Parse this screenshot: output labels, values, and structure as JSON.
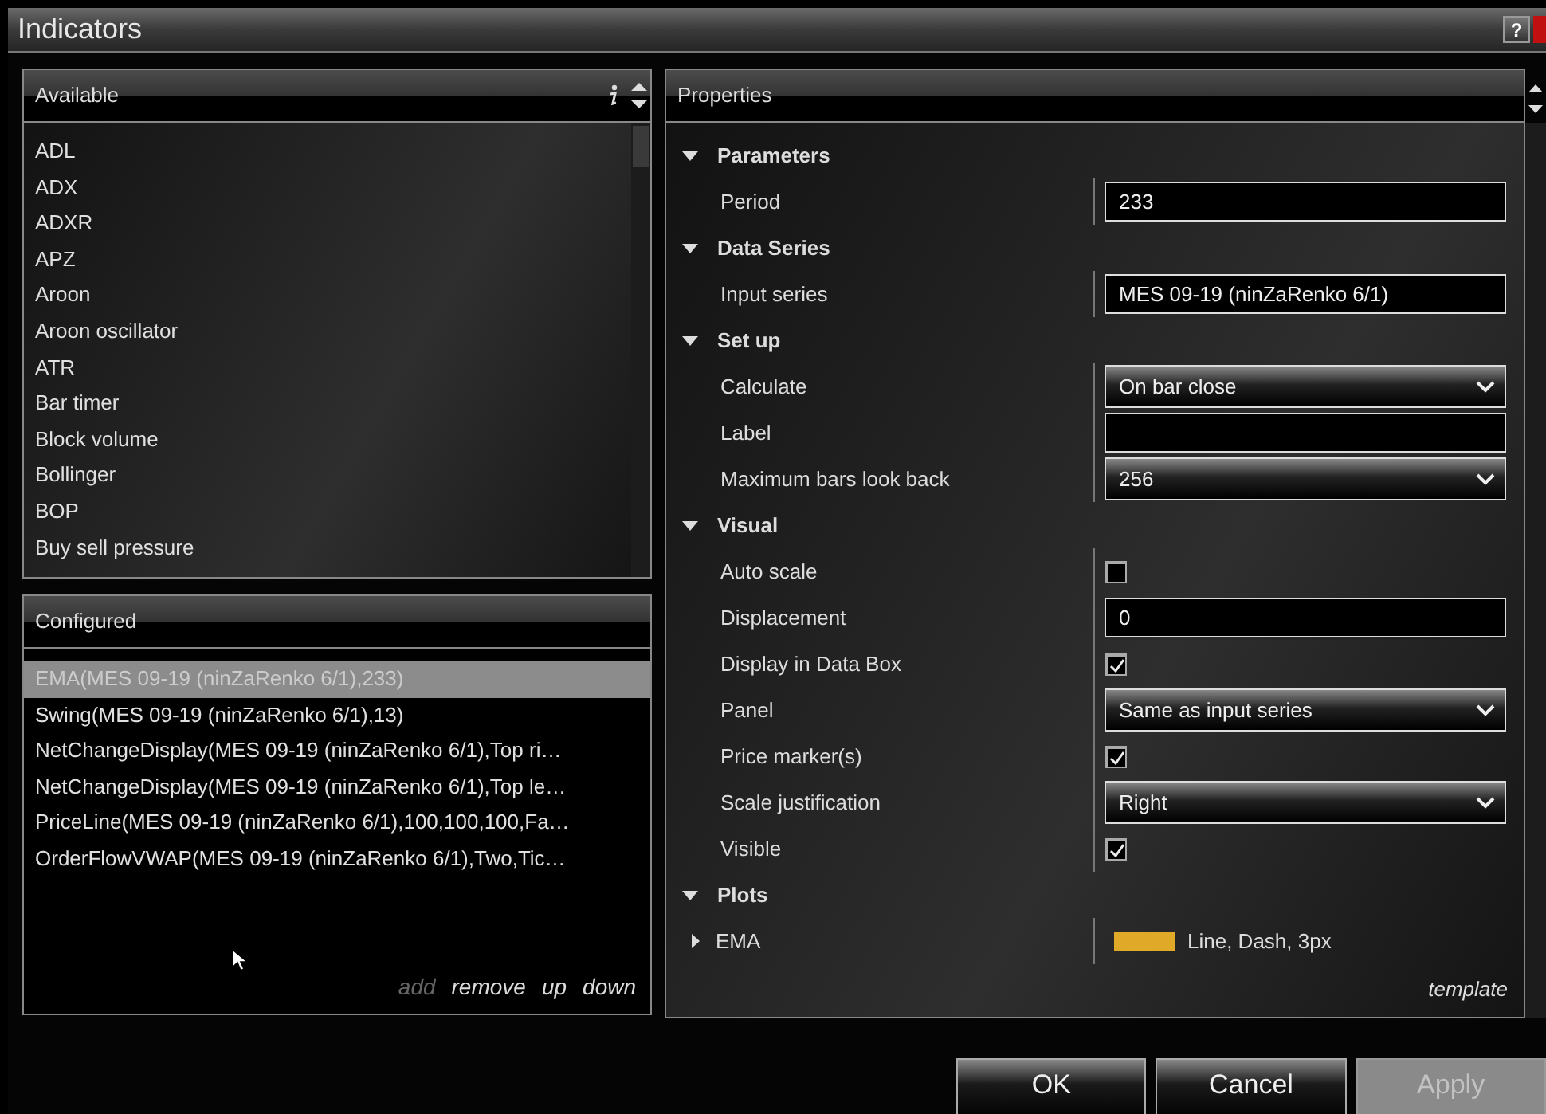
{
  "window": {
    "title": "Indicators",
    "help": "?"
  },
  "available": {
    "title": "Available",
    "items": [
      "ADL",
      "ADX",
      "ADXR",
      "APZ",
      "Aroon",
      "Aroon oscillator",
      "ATR",
      "Bar timer",
      "Block volume",
      "Bollinger",
      "BOP",
      "Buy sell pressure"
    ]
  },
  "configured": {
    "title": "Configured",
    "items": [
      {
        "label": "EMA(MES 09-19 (ninZaRenko 6/1),233)",
        "selected": true
      },
      {
        "label": "Swing(MES 09-19 (ninZaRenko 6/1),13)",
        "selected": false
      },
      {
        "label": "NetChangeDisplay(MES 09-19 (ninZaRenko 6/1),Top ri…",
        "selected": false
      },
      {
        "label": "NetChangeDisplay(MES 09-19 (ninZaRenko 6/1),Top le…",
        "selected": false
      },
      {
        "label": "PriceLine(MES 09-19 (ninZaRenko 6/1),100,100,100,Fa…",
        "selected": false
      },
      {
        "label": "OrderFlowVWAP(MES 09-19 (ninZaRenko 6/1),Two,Tic…",
        "selected": false
      }
    ],
    "actions": [
      {
        "label": "add",
        "disabled": true
      },
      {
        "label": "remove",
        "disabled": false
      },
      {
        "label": "up",
        "disabled": false
      },
      {
        "label": "down",
        "disabled": false
      }
    ]
  },
  "properties": {
    "title": "Properties",
    "groups": [
      {
        "name": "Parameters",
        "expanded": true,
        "rows": [
          {
            "label": "Period",
            "kind": "text",
            "value": "233"
          }
        ]
      },
      {
        "name": "Data Series",
        "expanded": true,
        "rows": [
          {
            "label": "Input series",
            "kind": "text",
            "value": "MES 09-19 (ninZaRenko 6/1)"
          }
        ]
      },
      {
        "name": "Set up",
        "expanded": true,
        "rows": [
          {
            "label": "Calculate",
            "kind": "dropdown",
            "value": "On bar close"
          },
          {
            "label": "Label",
            "kind": "text"
          },
          {
            "label": "Maximum bars look back",
            "kind": "dropdown",
            "value": "256"
          }
        ]
      },
      {
        "name": "Visual",
        "expanded": true,
        "rows": [
          {
            "label": "Auto scale",
            "kind": "checkbox",
            "checked": false
          },
          {
            "label": "Displacement",
            "kind": "text",
            "value": "0"
          },
          {
            "label": "Display in Data Box",
            "kind": "checkbox",
            "checked": true
          },
          {
            "label": "Panel",
            "kind": "dropdown",
            "value": "Same as input series"
          },
          {
            "label": "Price marker(s)",
            "kind": "checkbox",
            "checked": true
          },
          {
            "label": "Scale justification",
            "kind": "dropdown",
            "value": "Right"
          },
          {
            "label": "Visible",
            "kind": "checkbox",
            "checked": true
          }
        ]
      },
      {
        "name": "Plots",
        "expanded": true,
        "rows": [
          {
            "label": "EMA",
            "kind": "plot",
            "expanded": false,
            "color": "#e0aa28",
            "value": "Line, Dash, 3px"
          }
        ]
      }
    ],
    "template": "template"
  },
  "buttons": [
    {
      "label": "OK",
      "disabled": false
    },
    {
      "label": "Cancel",
      "disabled": false
    },
    {
      "label": "Apply",
      "disabled": true
    }
  ]
}
